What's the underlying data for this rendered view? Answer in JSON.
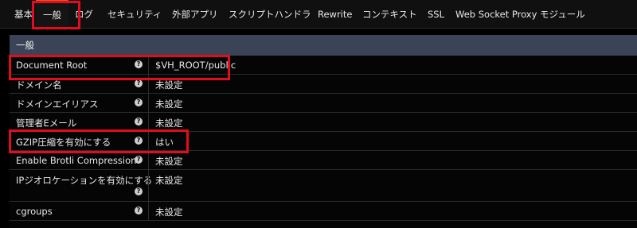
{
  "tabs": [
    {
      "label": "基本"
    },
    {
      "label": "一般"
    },
    {
      "label": "ログ"
    },
    {
      "label": "セキュリティ"
    },
    {
      "label": "外部アプリ"
    },
    {
      "label": "スクリプトハンドラ"
    },
    {
      "label": "Rewrite"
    },
    {
      "label": "コンテキスト"
    },
    {
      "label": "SSL"
    },
    {
      "label": "Web Socket Proxy"
    },
    {
      "label": "モジュール"
    }
  ],
  "active_tab": "一般",
  "panel": {
    "title": "一般",
    "rows": [
      {
        "label": "Document Root",
        "value": "$VH_ROOT/public"
      },
      {
        "label": "ドメイン名",
        "value": "未設定"
      },
      {
        "label": "ドメインエイリアス",
        "value": "未設定"
      },
      {
        "label": "管理者Eメール",
        "value": "未設定"
      },
      {
        "label": "GZIP圧縮を有効にする",
        "value": "はい"
      },
      {
        "label": "Enable Brotli Compression",
        "value": "未設定"
      },
      {
        "label": "IPジオロケーションを有効にする",
        "value": "未設定"
      },
      {
        "label": "cgroups",
        "value": "未設定"
      }
    ]
  },
  "help_glyph": "?",
  "colors": {
    "highlight": "#e10d1e",
    "active_tab_accent": "#e05a1e",
    "panel_header": "#3b4456"
  }
}
